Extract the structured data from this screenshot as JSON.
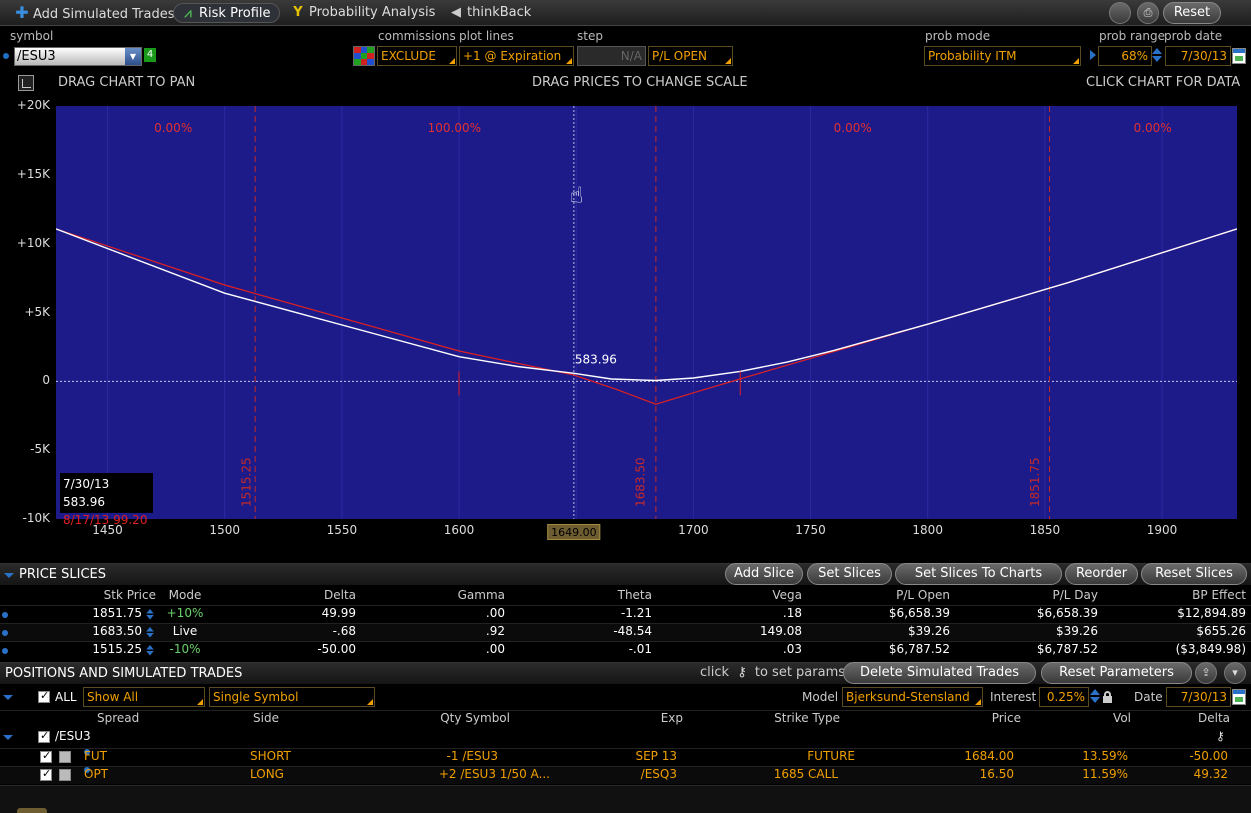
{
  "toolbar": {
    "tabs": [
      {
        "label": "Add Simulated Trades",
        "icon": "plus-icon"
      },
      {
        "label": "Risk Profile",
        "icon": "risk-profile-icon"
      },
      {
        "label": "Probability Analysis",
        "icon": "probability-icon"
      },
      {
        "label": "thinkBack",
        "icon": "thinkback-icon"
      }
    ],
    "reset_label": "Reset"
  },
  "controls": {
    "symbol_label": "symbol",
    "symbol_value": "/ESU3",
    "symbol_badge": "4",
    "commissions_label": "commissions",
    "commissions_value": "EXCLUDE",
    "plot_lines_label": "plot lines",
    "plot_lines_value": "+1 @ Expiration",
    "step_label": "step",
    "step_value": "N/A",
    "pl_value": "P/L OPEN",
    "prob_mode_label": "prob mode",
    "prob_mode_value": "Probability ITM",
    "prob_range_label": "prob range",
    "prob_range_value": "68%",
    "prob_date_label": "prob date",
    "prob_date_value": "7/30/13"
  },
  "chart_hints": {
    "left": "DRAG CHART TO PAN",
    "center": "DRAG PRICES TO CHANGE SCALE",
    "right": "CLICK CHART FOR DATA"
  },
  "chart_data": {
    "type": "line",
    "title": "",
    "xlabel": "",
    "ylabel": "",
    "xlim": [
      1428,
      1932
    ],
    "ylim": [
      -10000,
      20000
    ],
    "y_ticks": [
      {
        "v": 20000,
        "label": "+20K"
      },
      {
        "v": 15000,
        "label": "+15K"
      },
      {
        "v": 10000,
        "label": "+10K"
      },
      {
        "v": 5000,
        "label": "+5K"
      },
      {
        "v": 0,
        "label": "0"
      },
      {
        "v": -5000,
        "label": "-5K"
      },
      {
        "v": -10000,
        "label": "-10K"
      }
    ],
    "x_ticks": [
      1450,
      1500,
      1550,
      1600,
      1650,
      1700,
      1750,
      1800,
      1850,
      1900
    ],
    "x_highlight": {
      "x": 1649,
      "label": "1649.00"
    },
    "background": "#1d1b8a",
    "price_slices": [
      {
        "x": 1515.25,
        "label": "1515.25"
      },
      {
        "x": 1683.5,
        "label": "1683.50"
      },
      {
        "x": 1851.75,
        "label": "1851.75"
      }
    ],
    "prob_range_lines": [
      1513,
      1684,
      1852
    ],
    "probability_labels": [
      {
        "x": 1478,
        "label": "0.00%"
      },
      {
        "x": 1598,
        "label": "100.00%"
      },
      {
        "x": 1768,
        "label": "0.00%"
      },
      {
        "x": 1896,
        "label": "0.00%"
      }
    ],
    "cursor_x": 1649,
    "cursor_value_label": "583.96",
    "series": [
      {
        "name": "7/30/13",
        "color": "#ffffff",
        "x": [
          1428,
          1500,
          1600,
          1625,
          1649,
          1665,
          1684,
          1700,
          1720,
          1740,
          1760,
          1800,
          1860,
          1932
        ],
        "y": [
          11070,
          6400,
          1790,
          1080,
          584,
          170,
          60,
          240,
          720,
          1400,
          2250,
          4150,
          7170,
          11070
        ]
      },
      {
        "name": "8/17/13",
        "color": "#e02020",
        "x": [
          1428,
          1500,
          1600,
          1649,
          1667,
          1684,
          1700,
          1720,
          1740,
          1800,
          1860,
          1932
        ],
        "y": [
          11070,
          7000,
          2200,
          450,
          -570,
          -1660,
          -830,
          180,
          1170,
          4150,
          7170,
          11070
        ]
      }
    ],
    "legend": [
      {
        "date": "7/30/13",
        "value": "583.96"
      },
      {
        "date": "8/17/13",
        "value": "99.20"
      }
    ],
    "legend_position": "bottom-left"
  },
  "price_slices": {
    "title": "PRICE SLICES",
    "buttons": [
      "Add Slice",
      "Set Slices",
      "Set Slices To Charts",
      "Reorder",
      "Reset Slices"
    ],
    "columns": [
      "Stk Price",
      "Mode",
      "Delta",
      "Gamma",
      "Theta",
      "Vega",
      "P/L Open",
      "P/L Day",
      "BP Effect"
    ],
    "rows": [
      {
        "price": "1851.75",
        "mode": "+10%",
        "delta": "49.99",
        "gamma": ".00",
        "theta": "-1.21",
        "vega": ".18",
        "pl_open": "$6,658.39",
        "pl_day": "$6,658.39",
        "bp": "$12,894.89"
      },
      {
        "price": "1683.50",
        "mode": "Live",
        "delta": "-.68",
        "gamma": ".92",
        "theta": "-48.54",
        "vega": "149.08",
        "pl_open": "$39.26",
        "pl_day": "$39.26",
        "bp": "$655.26"
      },
      {
        "price": "1515.25",
        "mode": "-10%",
        "delta": "-50.00",
        "gamma": ".00",
        "theta": "-.01",
        "vega": ".03",
        "pl_open": "$6,787.52",
        "pl_day": "$6,787.52",
        "bp": "($3,849.98)"
      }
    ]
  },
  "positions": {
    "title": "POSITIONS AND SIMULATED TRADES",
    "click_text": "click",
    "click_text2": "to set params",
    "buttons": [
      "Delete Simulated Trades",
      "Reset Parameters"
    ],
    "all_label": "ALL",
    "filter_value": "Show All",
    "view_value": "Single Symbol",
    "model_label": "Model",
    "model_value": "Bjerksund-Stensland",
    "interest_label": "Interest",
    "interest_value": "0.25%",
    "date_label": "Date",
    "date_value": "7/30/13",
    "columns": [
      "Spread",
      "Side",
      "Qty Symbol",
      "Exp",
      "Strike Type",
      "Price",
      "Vol",
      "Delta"
    ],
    "group": "/ESU3",
    "rows": [
      {
        "spread": "FUT",
        "side": "SHORT",
        "qty_symbol": "-1 /ESU3",
        "exp": "SEP 13",
        "strike_type": "FUTURE",
        "price": "1684.00",
        "vol": "13.59%",
        "delta": "-50.00"
      },
      {
        "spread": "OPT",
        "side": "LONG",
        "qty_symbol": "+2 /ESU3 1/50 A...",
        "exp": "/ESQ3",
        "strike_type": "1685 CALL",
        "price": "16.50",
        "vol": "11.59%",
        "delta": "49.32"
      }
    ]
  }
}
